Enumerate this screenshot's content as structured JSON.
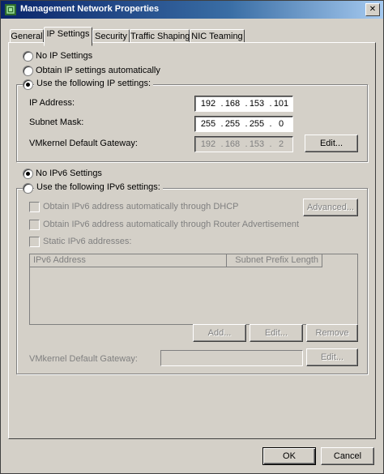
{
  "window": {
    "title": "Management Network Properties"
  },
  "tabs": [
    {
      "label": "General"
    },
    {
      "label": "IP Settings"
    },
    {
      "label": "Security"
    },
    {
      "label": "Traffic Shaping"
    },
    {
      "label": "NIC Teaming"
    }
  ],
  "ipv4": {
    "option_none": "No IP Settings",
    "option_auto": "Obtain IP settings automatically",
    "option_static": "Use the following IP settings:",
    "selected": "static",
    "ip_label": "IP Address:",
    "ip_octets": [
      "192",
      "168",
      "153",
      "101"
    ],
    "mask_label": "Subnet Mask:",
    "mask_octets": [
      "255",
      "255",
      "255",
      "0"
    ],
    "gateway_label": "VMkernel Default Gateway:",
    "gateway_octets": [
      "192",
      "168",
      "153",
      "2"
    ],
    "edit_label": "Edit..."
  },
  "ipv6": {
    "option_none": "No IPv6 Settings",
    "option_static": "Use the following IPv6 settings:",
    "selected": "none",
    "dhcp_label": "Obtain IPv6 address automatically through DHCP",
    "ra_label": "Obtain IPv6 address automatically through Router Advertisement",
    "static_label": "Static IPv6 addresses:",
    "advanced_label": "Advanced...",
    "table_columns": [
      "IPv6 Address",
      "Subnet Prefix Length"
    ],
    "add_label": "Add...",
    "edit_label": "Edit...",
    "remove_label": "Remove",
    "gateway_label": "VMkernel Default Gateway:",
    "gateway_edit_label": "Edit..."
  },
  "footer": {
    "ok_label": "OK",
    "cancel_label": "Cancel"
  }
}
